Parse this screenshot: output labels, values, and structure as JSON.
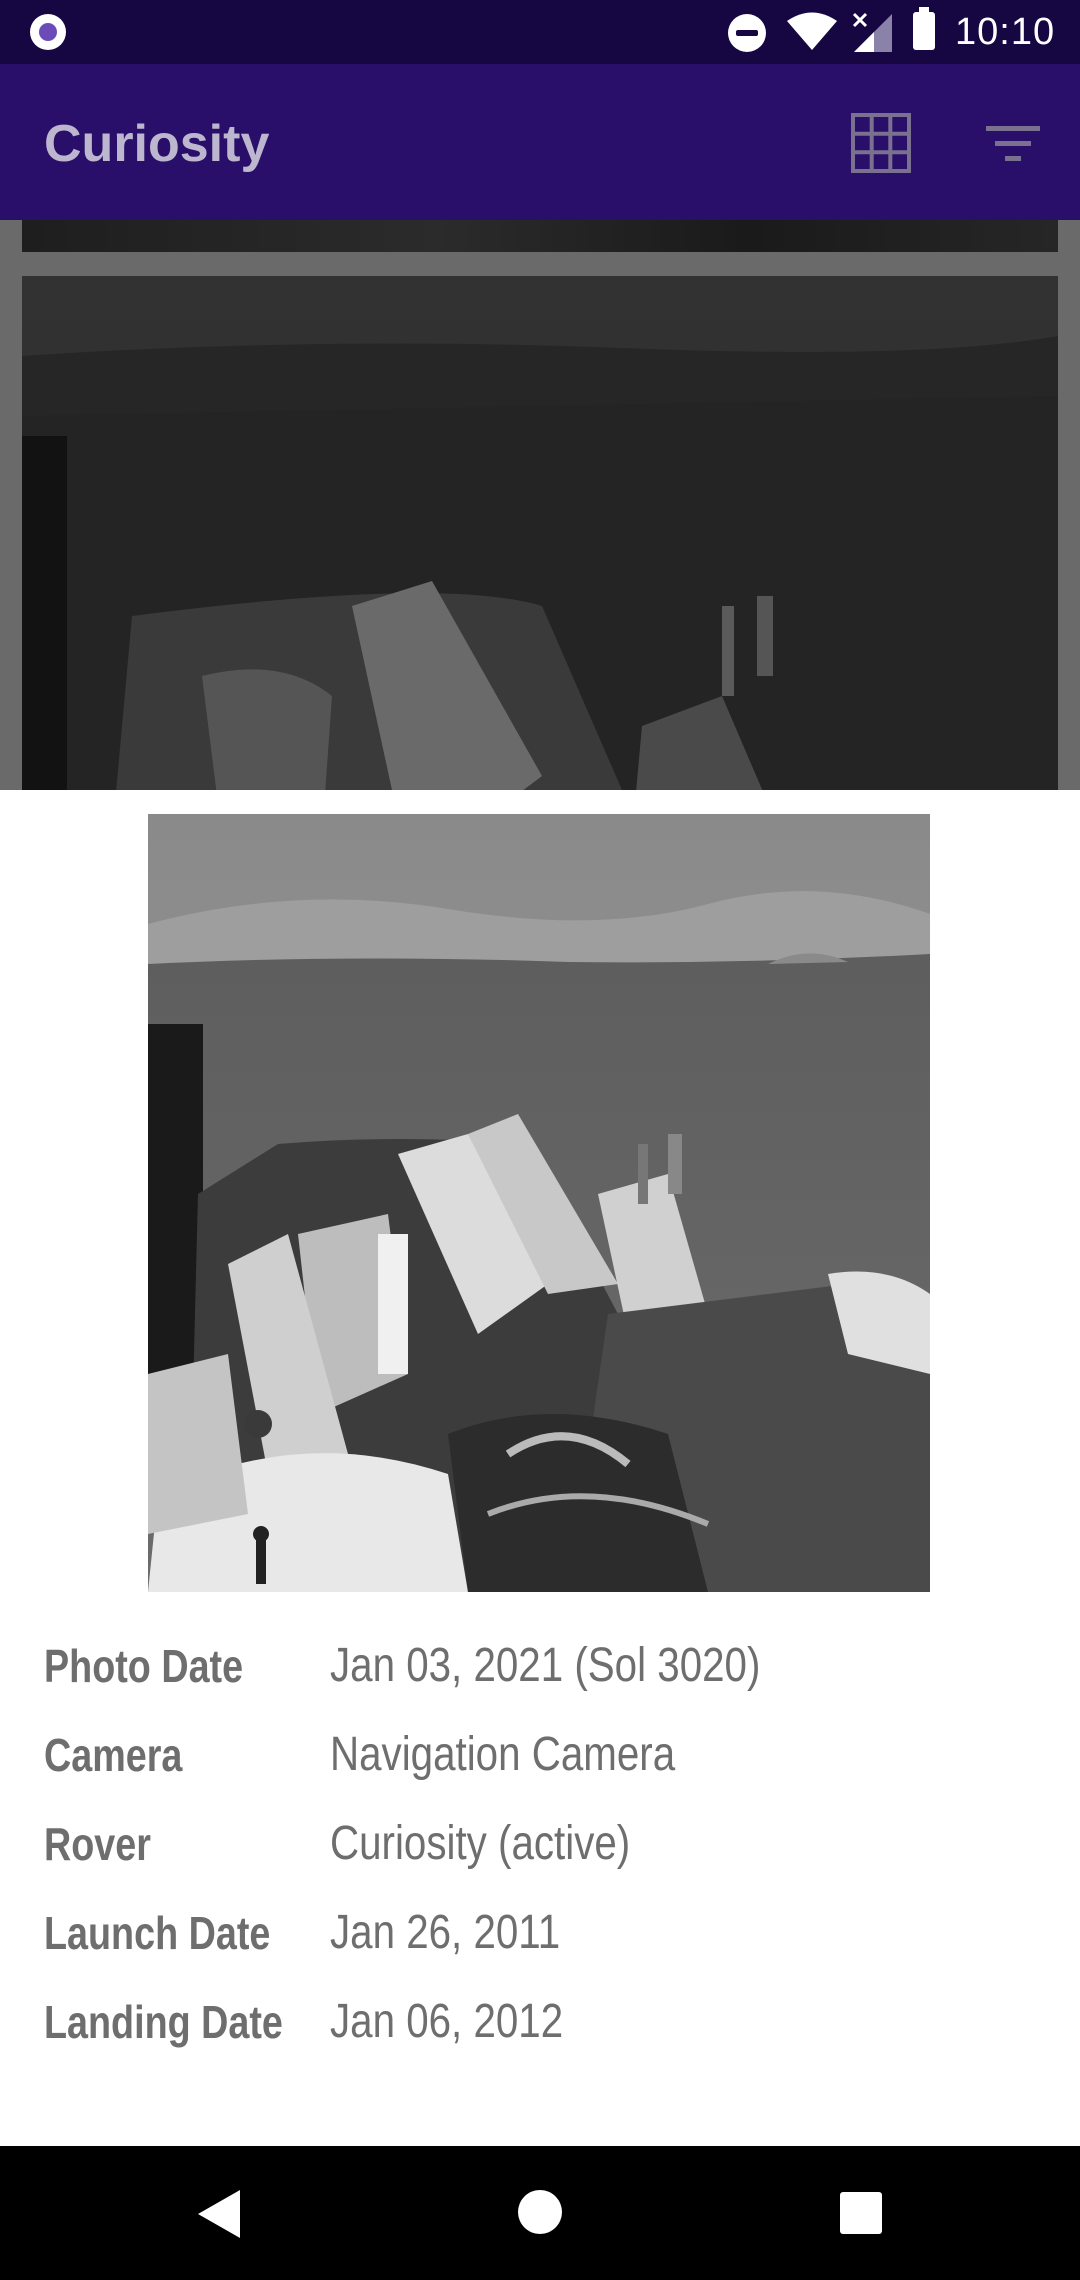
{
  "status_bar": {
    "time": "10:10",
    "icons": [
      "app-notification-icon",
      "do-not-disturb-icon",
      "wifi-icon",
      "signal-icon",
      "battery-icon"
    ]
  },
  "app_bar": {
    "title": "Curiosity",
    "actions": [
      "grid-view-icon",
      "filter-icon"
    ]
  },
  "photo_details": {
    "rows": [
      {
        "label": "Photo Date",
        "value": "Jan 03, 2021 (Sol 3020)"
      },
      {
        "label": "Camera",
        "value": "Navigation Camera"
      },
      {
        "label": "Rover",
        "value": "Curiosity (active)"
      },
      {
        "label": "Launch Date",
        "value": "Jan 26, 2011"
      },
      {
        "label": "Landing Date",
        "value": "Jan 06, 2012"
      }
    ]
  },
  "navigation_bar": {
    "buttons": [
      "back-icon",
      "home-icon",
      "recents-icon"
    ]
  },
  "colors": {
    "status_bar": "#160743",
    "app_bar": "#2a0f6a",
    "title_text": "#bdb6cf",
    "detail_text": "#6e6e6e",
    "nav_bar": "#000000"
  }
}
